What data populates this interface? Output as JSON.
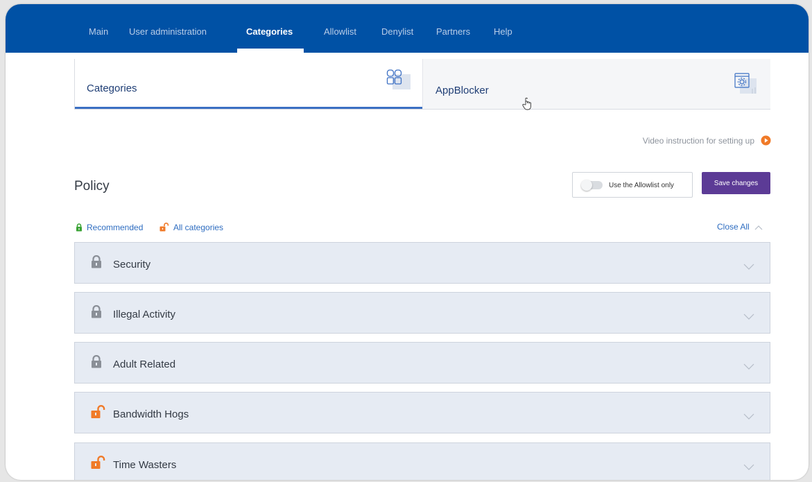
{
  "nav": {
    "tabs": [
      {
        "label": "Main"
      },
      {
        "label": "User administration"
      },
      {
        "label": "Categories"
      },
      {
        "label": "Allowlist"
      },
      {
        "label": "Denylist"
      },
      {
        "label": "Partners"
      },
      {
        "label": "Help"
      }
    ],
    "active": "Categories"
  },
  "product_tabs": [
    {
      "label": "Categories",
      "icon": "grid-icon",
      "active": true
    },
    {
      "label": "AppBlocker",
      "icon": "app-settings-icon",
      "active": false
    }
  ],
  "video_link": "Video instruction for setting up",
  "policy": {
    "title": "Policy",
    "toggle_label": "Use the Allowlist only",
    "toggle_on": false,
    "save_label": "Save changes"
  },
  "legend": {
    "recommended": "Recommended",
    "all_categories": "All categories"
  },
  "close_all": "Close All",
  "categories": [
    {
      "name": "Security",
      "lock": "locked"
    },
    {
      "name": "Illegal Activity",
      "lock": "locked"
    },
    {
      "name": "Adult Related",
      "lock": "locked"
    },
    {
      "name": "Bandwidth Hogs",
      "lock": "unlocked"
    },
    {
      "name": "Time Wasters",
      "lock": "unlocked"
    }
  ],
  "colors": {
    "nav_bg": "#0051a5",
    "accent_blue": "#3b6fc3",
    "save_button": "#5c3b96",
    "row_bg": "#e6ebf3",
    "unlocked_orange": "#f07a28",
    "recommended_green": "#3aa335"
  }
}
